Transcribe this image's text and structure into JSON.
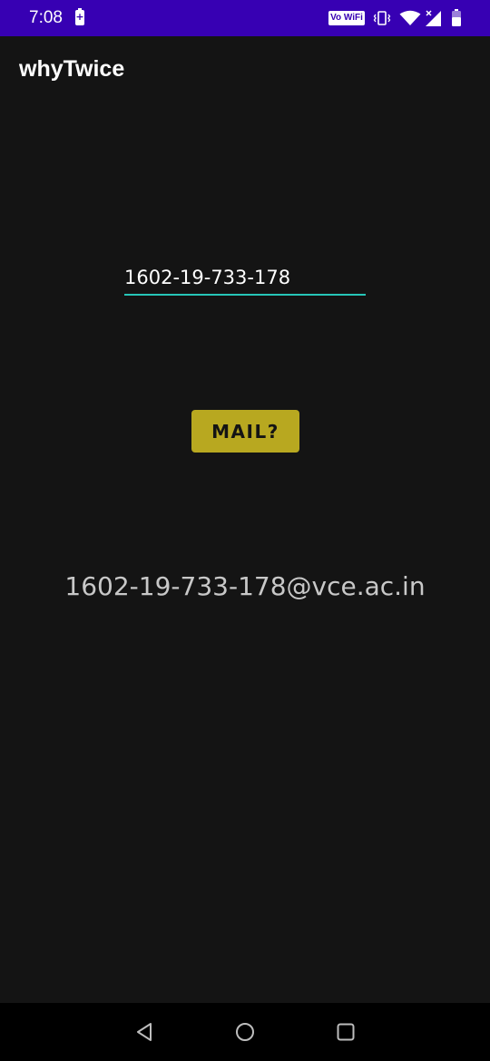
{
  "status_bar": {
    "time": "7:08",
    "vowifi_label": "Vo WiFi",
    "icons": [
      "battery-saver-icon",
      "vowifi-icon",
      "vibrate-icon",
      "wifi-icon",
      "signal-icon",
      "battery-icon"
    ]
  },
  "app_bar": {
    "title": "whyTwice"
  },
  "form": {
    "input_value": "1602-19-733-178",
    "button_label": "MAIL?"
  },
  "result": {
    "email": "1602-19-733-178@vce.ac.in"
  },
  "nav_bar": {
    "icons": [
      "back-icon",
      "home-icon",
      "recents-icon"
    ]
  },
  "colors": {
    "status_bar": "#3700b3",
    "background": "#141414",
    "accent_underline": "#26c6b8",
    "button": "#b8a820",
    "nav_bar": "#000000"
  }
}
